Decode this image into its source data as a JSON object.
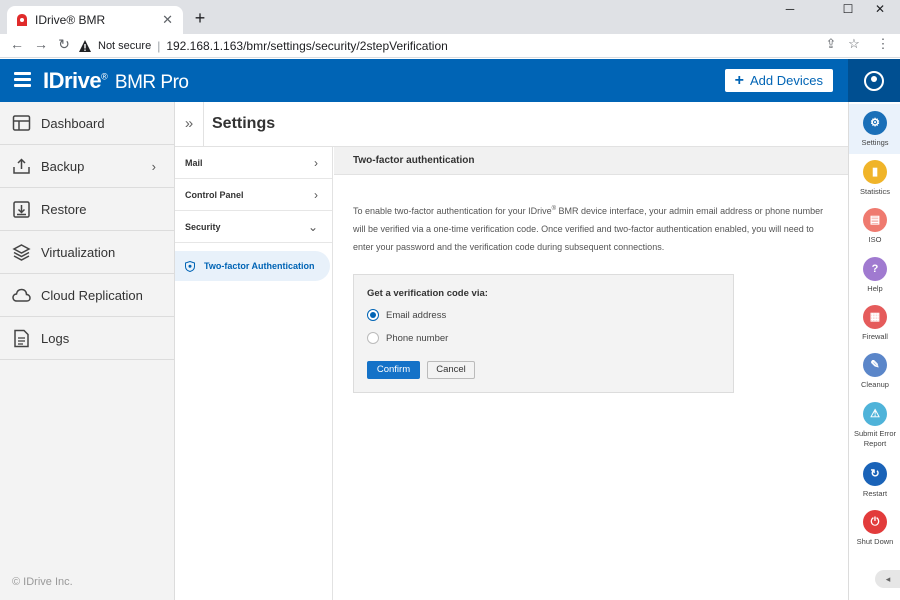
{
  "browser": {
    "tab_title": "IDrive® BMR",
    "tab_close": "✕",
    "new_tab": "+",
    "minimize": "─",
    "maximize": "☐",
    "close": "✕",
    "not_secure": "Not secure",
    "url": "192.168.1.163/bmr/settings/security/2stepVerification"
  },
  "header": {
    "brand": "IDrive",
    "brand_reg": "®",
    "product": "BMR Pro",
    "add_devices": "Add Devices"
  },
  "sidebar": {
    "items": [
      {
        "label": "Dashboard"
      },
      {
        "label": "Backup"
      },
      {
        "label": "Restore"
      },
      {
        "label": "Virtualization"
      },
      {
        "label": "Cloud Replication"
      },
      {
        "label": "Logs"
      }
    ],
    "copyright": "© IDrive Inc."
  },
  "settings": {
    "title": "Settings",
    "menu": [
      {
        "label": "Mail"
      },
      {
        "label": "Control Panel"
      },
      {
        "label": "Security"
      }
    ],
    "active_sub": "Two-factor Authentication"
  },
  "content": {
    "heading": "Two-factor authentication",
    "desc_part1": "To enable two-factor authentication for your IDrive",
    "desc_reg": "®",
    "desc_part2": " BMR device interface, your admin email address or phone number will be verified via a one-time verification code. Once verified and two-factor authentication enabled, you will need to enter your password and the verification code during subsequent connections.",
    "box_title": "Get a verification code via:",
    "option_email": "Email address",
    "option_phone": "Phone number",
    "selected_option": "email",
    "confirm": "Confirm",
    "cancel": "Cancel"
  },
  "rail": {
    "items": [
      {
        "label": "Settings",
        "icon": "gear-icon",
        "color": "#1a6fb8"
      },
      {
        "label": "Statistics",
        "icon": "chart-icon",
        "color": "#f0b429"
      },
      {
        "label": "ISO",
        "icon": "document-icon",
        "color": "#ef7a6f"
      },
      {
        "label": "Help",
        "icon": "question-icon",
        "color": "#a07ad0"
      },
      {
        "label": "Firewall",
        "icon": "firewall-icon",
        "color": "#e55b5b"
      },
      {
        "label": "Cleanup",
        "icon": "broom-icon",
        "color": "#5b86c9"
      },
      {
        "label": "Submit Error Report",
        "icon": "warning-icon",
        "color": "#4fb3d9"
      },
      {
        "label": "Restart",
        "icon": "restart-icon",
        "color": "#1a63b8"
      },
      {
        "label": "Shut Down",
        "icon": "power-icon",
        "color": "#e23b3b"
      }
    ]
  },
  "colors": {
    "brand_blue": "#0064b5",
    "confirm_blue": "#1472c8"
  }
}
